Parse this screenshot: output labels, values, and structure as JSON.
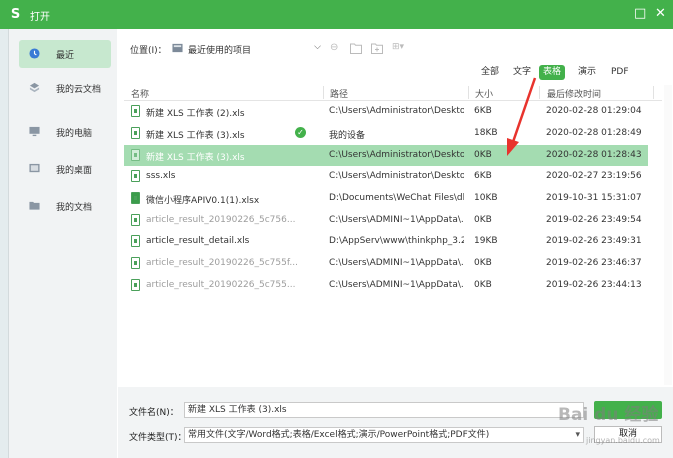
{
  "window": {
    "title": "打开",
    "logo": "S",
    "icon": "wps-logo-icon",
    "restore_glyph": "□",
    "close_glyph": "✕"
  },
  "sidebar": {
    "items": [
      {
        "label": "最近",
        "icon": "clock-icon",
        "active": true
      },
      {
        "label": "我的云文档",
        "icon": "cloud-doc-icon"
      },
      {
        "label": "我的电脑",
        "icon": "computer-icon"
      },
      {
        "label": "我的桌面",
        "icon": "desktop-icon"
      },
      {
        "label": "我的文档",
        "icon": "folder-icon"
      }
    ]
  },
  "location": {
    "label": "位置(I)：",
    "value": "最近使用的项目"
  },
  "filters": [
    {
      "label": "全部"
    },
    {
      "label": "文字"
    },
    {
      "label": "表格",
      "active": true
    },
    {
      "label": "演示"
    },
    {
      "label": "PDF"
    }
  ],
  "columns": {
    "name": "名称",
    "path": "路径",
    "size": "大小",
    "date": "最后修改时间"
  },
  "files": [
    {
      "name": "新建 XLS 工作表 (2).xls",
      "path": "C:\\Users\\Administrator\\Desktop",
      "size": "6KB",
      "date": "2020-02-28 01:29:04",
      "state": "normal"
    },
    {
      "name": "新建 XLS 工作表 (3).xls",
      "path": "我的设备",
      "size": "18KB",
      "date": "2020-02-28 01:28:49",
      "state": "normal",
      "synced": true
    },
    {
      "name": "新建 XLS 工作表 (3).xls",
      "path": "C:\\Users\\Administrator\\Desktop",
      "size": "0KB",
      "date": "2020-02-28 01:28:43",
      "state": "selected"
    },
    {
      "name": "sss.xls",
      "path": "C:\\Users\\Administrator\\Deskto...",
      "size": "6KB",
      "date": "2020-02-27 23:19:56",
      "state": "normal"
    },
    {
      "name": "微信小程序APIV0.1(1).xlsx",
      "path": "D:\\Documents\\WeChat Files\\dk...",
      "size": "10KB",
      "date": "2019-10-31 15:31:07",
      "state": "normal",
      "icon": "solid"
    },
    {
      "name": "article_result_20190226_5c756...",
      "path": "C:\\Users\\ADMINI~1\\AppData\\...",
      "size": "0KB",
      "date": "2019-02-26 23:49:54",
      "state": "dim"
    },
    {
      "name": "article_result_detail.xls",
      "path": "D:\\AppServ\\www\\thinkphp_3.2...",
      "size": "19KB",
      "date": "2019-02-26 23:49:31",
      "state": "normal"
    },
    {
      "name": "article_result_20190226_5c755f...",
      "path": "C:\\Users\\ADMINI~1\\AppData\\...",
      "size": "0KB",
      "date": "2019-02-26 23:46:37",
      "state": "dim"
    },
    {
      "name": "article_result_20190226_5c755...",
      "path": "C:\\Users\\ADMINI~1\\AppData\\...",
      "size": "0KB",
      "date": "2019-02-26 23:44:13",
      "state": "dim"
    }
  ],
  "bottom": {
    "filename_label": "文件名(N)：",
    "filename_value": "新建 XLS 工作表 (3).xls",
    "filetype_label": "文件类型(T)：",
    "filetype_value": "常用文件(文字/Word格式;表格/Excel格式;演示/PowerPoint格式;PDF文件)",
    "cancel_label": "取消"
  },
  "watermark": {
    "text": "Bai du 经验",
    "sub": "jingyan.baidu.com"
  },
  "colors": {
    "accent": "#43b14b",
    "selected_row": "#a4dcb1",
    "annotation_arrow": "#e8332d"
  }
}
